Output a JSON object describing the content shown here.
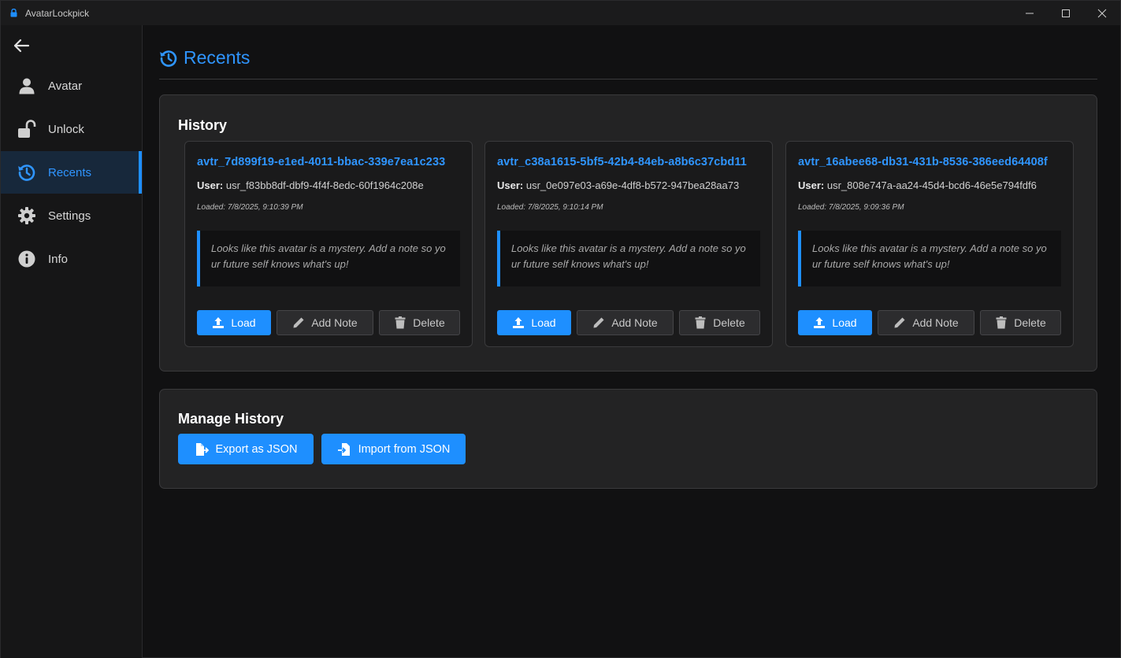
{
  "window": {
    "title": "AvatarLockpick",
    "accent_color": "#1e8fff"
  },
  "sidebar": {
    "back_icon": "arrow-left-icon",
    "items": [
      {
        "label": "Avatar",
        "icon": "user-icon"
      },
      {
        "label": "Unlock",
        "icon": "unlock-icon"
      },
      {
        "label": "Recents",
        "icon": "history-icon",
        "active": true
      },
      {
        "label": "Settings",
        "icon": "gear-icon"
      },
      {
        "label": "Info",
        "icon": "info-icon"
      }
    ]
  },
  "page": {
    "title": "Recents",
    "icon": "history-icon"
  },
  "history": {
    "title": "History",
    "user_prefix": "User:",
    "cards": [
      {
        "avatar_id": "avtr_7d899f19-e1ed-4011-bbac-339e7ea1c233",
        "user": "usr_f83bb8df-dbf9-4f4f-8edc-60f1964c208e",
        "loaded": "Loaded: 7/8/2025, 9:10:39 PM",
        "note": "Looks like this avatar is a mystery. Add a note so your future self knows what's up!"
      },
      {
        "avatar_id": "avtr_c38a1615-5bf5-42b4-84eb-a8b6c37cbd11",
        "user": "usr_0e097e03-a69e-4df8-b572-947bea28aa73",
        "loaded": "Loaded: 7/8/2025, 9:10:14 PM",
        "note": "Looks like this avatar is a mystery. Add a note so your future self knows what's up!"
      },
      {
        "avatar_id": "avtr_16abee68-db31-431b-8536-386eed64408f",
        "user": "usr_808e747a-aa24-45d4-bcd6-46e5e794fdf6",
        "loaded": "Loaded: 7/8/2025, 9:09:36 PM",
        "note": "Looks like this avatar is a mystery. Add a note so your future self knows what's up!"
      }
    ],
    "buttons": {
      "load": "Load",
      "add_note": "Add Note",
      "delete": "Delete"
    }
  },
  "manage": {
    "title": "Manage History",
    "export_label": "Export as JSON",
    "import_label": "Import from JSON"
  }
}
